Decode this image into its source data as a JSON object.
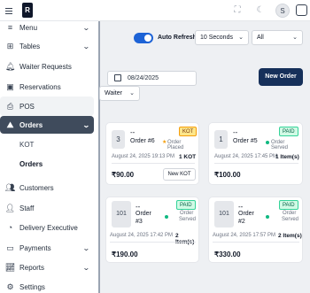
{
  "topbar": {
    "logo_letter": "R"
  },
  "user": {
    "initial": "S"
  },
  "sidebar": {
    "items": [
      {
        "label": "Menu",
        "icon": "menu-icon",
        "chevron": true
      },
      {
        "label": "Tables",
        "icon": "tables-icon",
        "chevron": true
      },
      {
        "label": "Waiter Requests",
        "icon": "bell-icon",
        "chevron": false
      },
      {
        "label": "Reservations",
        "icon": "calendar-icon",
        "chevron": false
      },
      {
        "label": "POS",
        "icon": "pos-icon",
        "chevron": false
      },
      {
        "label": "Orders",
        "icon": "orders-icon",
        "chevron": true
      },
      {
        "label": "Customers",
        "icon": "users-icon",
        "chevron": false
      },
      {
        "label": "Staff",
        "icon": "staff-icon",
        "chevron": false
      },
      {
        "label": "Delivery Executive",
        "icon": "delivery-icon",
        "chevron": false
      },
      {
        "label": "Payments",
        "icon": "payments-icon",
        "chevron": true
      },
      {
        "label": "Reports",
        "icon": "reports-icon",
        "chevron": true
      },
      {
        "label": "Settings",
        "icon": "settings-icon",
        "chevron": false
      }
    ],
    "subitems": [
      "KOT",
      "Orders"
    ]
  },
  "filters": {
    "auto_refresh_label": "Auto Refresh",
    "interval": "10 Seconds",
    "status_filter": "All",
    "date": "08/24/2025",
    "waiter": "Waiter",
    "new_order_label": "New Order"
  },
  "orders": [
    {
      "token": "3",
      "dash": "--",
      "order_no": "Order #6",
      "badge": "KOT",
      "status": "Order Placed",
      "datetime": "August 24, 2025 19:13 PM",
      "count": "1 KOT",
      "amount": "₹90.00",
      "action": "New KOT"
    },
    {
      "token": "1",
      "dash": "--",
      "order_no": "Order #5",
      "badge": "PAID",
      "status": "Order Served",
      "datetime": "August 24, 2025 17:45 PM",
      "count": "1 Item(s)",
      "amount": "₹100.00"
    },
    {
      "token": "101",
      "dash": "--",
      "order_line1": "Order",
      "order_line2": "#3",
      "badge": "PAID",
      "status_line1": "Order",
      "status_line2": "Served",
      "datetime": "August 24, 2025 17:42 PM",
      "count": "2 Item(s)",
      "amount": "₹190.00"
    },
    {
      "token": "101",
      "dash": "--",
      "order_line1": "Order",
      "order_line2": "#2",
      "badge": "PAID",
      "status_line1": "Order",
      "status_line2": "Served",
      "datetime": "August 24, 2025 17:57 PM",
      "count": "2 Item(s)",
      "amount": "₹330.00"
    }
  ],
  "colors": {
    "accent": "#1d63d6",
    "active_nav": "#3f4b5c",
    "primary_button": "#16305a",
    "kot_badge": "#fde68a",
    "paid_badge": "#d1fae5"
  }
}
